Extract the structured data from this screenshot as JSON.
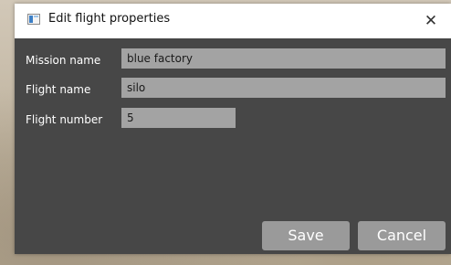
{
  "window": {
    "title": "Edit flight properties",
    "close_glyph": "✕"
  },
  "form": {
    "mission_name": {
      "label": "Mission name",
      "value": "blue factory"
    },
    "flight_name": {
      "label": "Flight name",
      "value": "silo"
    },
    "flight_number": {
      "label": "Flight number",
      "value": "5"
    }
  },
  "buttons": {
    "save_label": "Save",
    "cancel_label": "Cancel"
  },
  "colors": {
    "dialog_bg": "#474747",
    "input_bg": "#a3a3a3",
    "button_bg": "#9a9a9a",
    "titlebar_bg": "#ffffff"
  },
  "icons": {
    "window_icon": "app-window-icon",
    "close_icon": "close-icon"
  }
}
